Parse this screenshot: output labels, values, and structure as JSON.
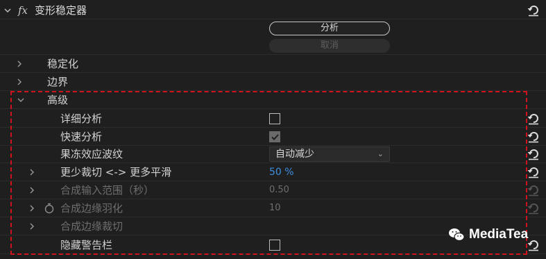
{
  "effect": {
    "fx_symbol": "fx",
    "title": "变形稳定器"
  },
  "buttons": {
    "analyze_label": "分析",
    "cancel_label": "取消"
  },
  "sections": {
    "stabilization": "稳定化",
    "borders": "边界",
    "advanced": "高级"
  },
  "advanced": {
    "detailed_analysis": {
      "label": "详细分析",
      "checked": false
    },
    "fast_analysis": {
      "label": "快速分析",
      "checked": true
    },
    "rolling_shutter": {
      "label": "果冻效应波纹",
      "value": "自动减少"
    },
    "less_crop_more_smooth": {
      "label": "更少裁切 <-> 更多平滑",
      "value": "50",
      "unit": "%"
    },
    "synthesis_input_range": {
      "label": "合成输入范围（秒）",
      "value": "0.50"
    },
    "synthesis_edge_feather": {
      "label": "合成边缘羽化",
      "value": "10"
    },
    "synthesis_edge_crop": {
      "label": "合成边缘裁切"
    },
    "hide_warning_banner": {
      "label": "隐藏警告栏",
      "checked": false
    }
  },
  "watermark": {
    "text": "MediaTea"
  },
  "colors": {
    "highlight_frame": "#d0131d",
    "value_blue": "#3d8fe0"
  }
}
